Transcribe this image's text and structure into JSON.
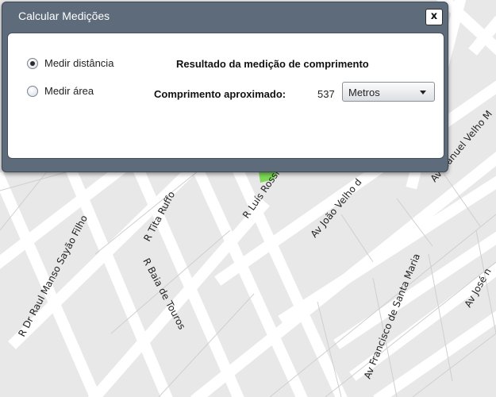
{
  "map": {
    "streets": [
      "R Dr Raul Manso Sayão Filho",
      "R Tita Ruffo",
      "R Baia de Touros",
      "R Luís Rossi",
      "Av João Velho d",
      "Av Francisco de Santa Maria",
      "Av Manuel Velho M",
      "Av José n"
    ]
  },
  "dialog": {
    "title": "Calcular Medições",
    "close_label": "x",
    "options": [
      {
        "label": "Medir distância",
        "selected": true
      },
      {
        "label": "Medir área",
        "selected": false
      }
    ],
    "result_title": "Resultado da medição de comprimento",
    "length_label": "Comprimento aproximado:",
    "length_value": "537",
    "unit": {
      "selected": "Metros"
    }
  }
}
